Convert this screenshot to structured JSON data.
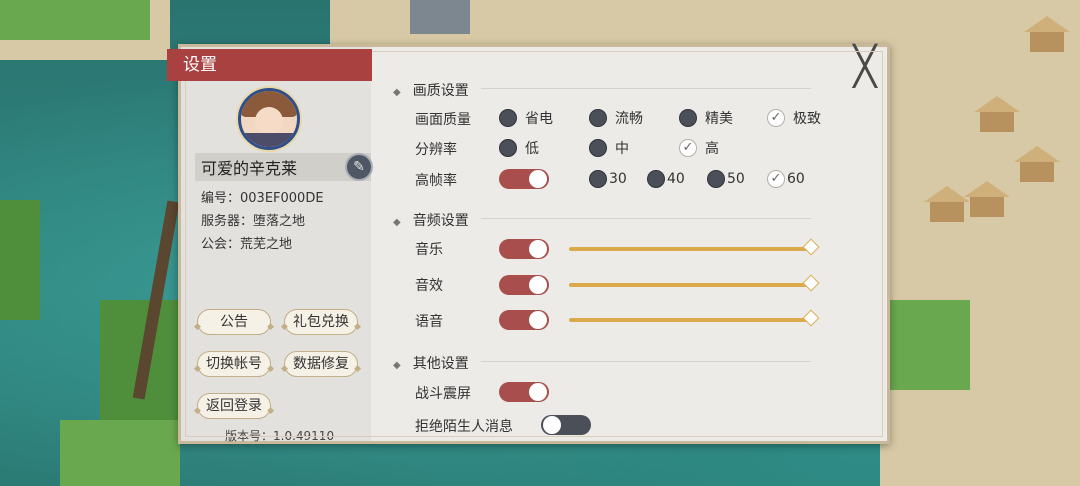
{
  "panel": {
    "title": "设置",
    "close_label": "╳"
  },
  "profile": {
    "name": "可爱的辛克莱",
    "id_line": "编号：003EF000DE",
    "server_line": "服务器：堕落之地",
    "guild_line": "公会：荒芜之地"
  },
  "buttons": {
    "notice": "公告",
    "gift": "礼包兑换",
    "switch_account": "切换帐号",
    "repair": "数据修复",
    "back_login": "返回登录"
  },
  "version": "版本号：1.0.49110",
  "graphics": {
    "section": "画质设置",
    "quality_label": "画面质量",
    "quality_options": [
      "省电",
      "流畅",
      "精美",
      "极致"
    ],
    "quality_selected": "极致",
    "resolution_label": "分辨率",
    "resolution_options": [
      "低",
      "中",
      "高"
    ],
    "resolution_selected": "高",
    "fps_label": "高帧率",
    "fps_enabled": true,
    "fps_options": [
      "30",
      "40",
      "50",
      "60"
    ],
    "fps_selected": "60"
  },
  "audio": {
    "section": "音频设置",
    "music_label": "音乐",
    "music_enabled": true,
    "music_level": 1.0,
    "sfx_label": "音效",
    "sfx_enabled": true,
    "sfx_level": 1.0,
    "voice_label": "语音",
    "voice_enabled": true,
    "voice_level": 1.0
  },
  "other": {
    "section": "其他设置",
    "shake_label": "战斗震屏",
    "shake_enabled": true,
    "reject_label": "拒绝陌生人消息",
    "reject_enabled": false
  },
  "colors": {
    "title_bar": "#a8413f",
    "toggle_on": "#a84f4d",
    "toggle_off": "#4a4f58",
    "slider": "#d9a94a"
  }
}
